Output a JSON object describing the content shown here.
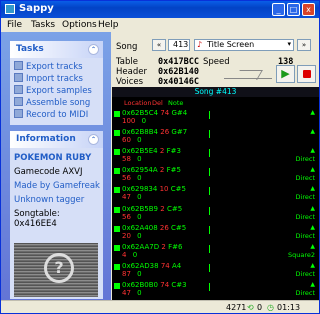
{
  "window": {
    "title": "Sappy"
  },
  "menu": [
    "File",
    "Tasks",
    "Options",
    "Help"
  ],
  "tasks": {
    "title": "Tasks",
    "items": [
      "Export tracks",
      "Import tracks",
      "Export samples",
      "Assemble song",
      "Record to MIDI"
    ]
  },
  "information": {
    "title": "Information",
    "game": "POKEMON RUBY",
    "gamecode": "Gamecode AXVJ",
    "made_by": "Made by Gamefreak",
    "tagger": "Unknown tagger",
    "songtable": "Songtable: 0x416EE4"
  },
  "song": {
    "label": "Song",
    "prev": "«",
    "number": "413",
    "song_name": "Title Screen",
    "next": "»"
  },
  "details": {
    "table_label": "Table",
    "table": "0x417BCC",
    "speed_label": "Speed",
    "speed": "138",
    "header_label": "Header",
    "header": "0x62B140",
    "voices_label": "Voices",
    "voices": "0x40146C"
  },
  "tracklist": {
    "title": "Song #413",
    "columns": [
      "Location",
      "Del",
      "Note"
    ],
    "rows": [
      {
        "loc": "0x62B5C4",
        "val1": "74",
        "note": "G#4",
        "n1": "100",
        "n2": "0",
        "extra": ""
      },
      {
        "loc": "0x62B8B4",
        "val1": "26",
        "note": "G#7",
        "n1": "60",
        "n2": "0",
        "extra": ""
      },
      {
        "loc": "0x62B5E4",
        "val1": "2",
        "note": "F#3",
        "n1": "58",
        "n2": "0",
        "extra": "Direct"
      },
      {
        "loc": "0x62954A",
        "val1": "2",
        "note": "F#5",
        "n1": "56",
        "n2": "0",
        "extra": "Direct"
      },
      {
        "loc": "0x629834",
        "val1": "10",
        "note": "C#5",
        "n1": "47",
        "n2": "0",
        "extra": "Direct"
      },
      {
        "loc": "0x62B5B9",
        "val1": "2",
        "note": "C#5",
        "n1": "56",
        "n2": "0",
        "extra": "Direct"
      },
      {
        "loc": "0x62A408",
        "val1": "26",
        "note": "C#5",
        "n1": "20",
        "n2": "0",
        "extra": "Direct"
      },
      {
        "loc": "0x62AA7D",
        "val1": "2",
        "note": "F#6",
        "n1": "4",
        "n2": "0",
        "extra": "Square2"
      },
      {
        "loc": "0x62AD38",
        "val1": "74",
        "note": "A4",
        "n1": "87",
        "n2": "0",
        "extra": "Direct"
      },
      {
        "loc": "0x62B0B0",
        "val1": "74",
        "note": "C#3",
        "n1": "47",
        "n2": "0",
        "extra": "Direct"
      }
    ]
  },
  "status": {
    "count": "4271",
    "loops": "0",
    "time": "01:13 (88)"
  },
  "colors": {
    "accent": "#215dc6",
    "track_green": "#00ff00",
    "track_red": "#ff3333"
  }
}
